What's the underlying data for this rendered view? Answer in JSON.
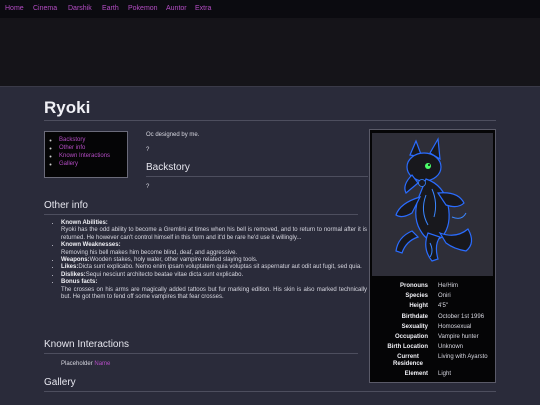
{
  "nav": [
    "Home",
    "Cinema",
    "Darshik",
    "Earth",
    "Pokemon",
    "Auntor",
    "Extra"
  ],
  "page_title": "Ryoki",
  "toc": [
    "Backstory",
    "Other info",
    "Known Interactions",
    "Gallery"
  ],
  "intro": "Oc designed by me.",
  "intro_q": "?",
  "backstory": {
    "heading": "Backstory",
    "text": "?"
  },
  "other_info": {
    "heading": "Other info",
    "abilities_label": "Known Abilities:",
    "abilities_text": "Ryoki has the odd ability to become a Gremlini at times when his bell is removed, and to return to normal after it is returned. He however can't control himself in this form and it'd be rare he'd use it willingly...",
    "weaknesses_label": "Known Weaknesses:",
    "weaknesses_text": "Removing his bell makes him become blind, deaf, and aggressive.",
    "weapons_label": "Weapons:",
    "weapons_text": "Wooden stakes, holy water, other vampire related slaying tools.",
    "likes_label": "Likes:",
    "likes_text": "Dicta sunt explicabo. Nemo enim ipsam voluptatem quia voluptas sit aspernatur aut odit aut fugit, sed quia.",
    "dislikes_label": "Dislikes:",
    "dislikes_text": "Sequi nesciunt architecto beatae vitae dicta sunt explicabo.",
    "bonus_label": "Bonus facts:",
    "bonus_text": "The crosses on his arms are magically added tattoos but fur marking edition. His skin is also marked technically but. He got them to fend off some vampires that fear crosses."
  },
  "known_interactions": {
    "heading": "Known Interactions",
    "placeholder": "Placeholder",
    "link": "Name"
  },
  "gallery": {
    "heading": "Gallery"
  },
  "infobox": {
    "rows": [
      {
        "key": "Pronouns",
        "value": "He/Him"
      },
      {
        "key": "Species",
        "value": "Oniri"
      },
      {
        "key": "Height",
        "value": "4'5\""
      },
      {
        "key": "Birthdate",
        "value": "October 1st 1996"
      },
      {
        "key": "Sexuality",
        "value": "Homosexual"
      },
      {
        "key": "Occupation",
        "value": "Vampire hunter"
      },
      {
        "key": "Birth Location",
        "value": "Unknown"
      },
      {
        "key": "Current Residence",
        "value": "Living with Ayarsto"
      },
      {
        "key": "Element",
        "value": "Light"
      }
    ]
  },
  "colors": {
    "accent": "#b44cc4",
    "background": "#2a2b3a",
    "panel": "#050506"
  }
}
